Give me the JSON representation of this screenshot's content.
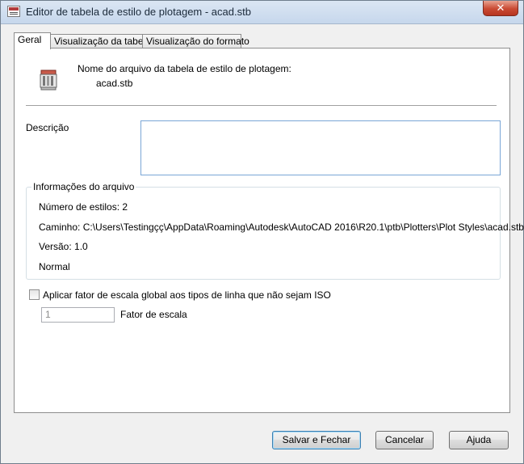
{
  "window": {
    "title": "Editor de tabela de estilo de plotagem - acad.stb",
    "close_glyph": "✕"
  },
  "tabs": [
    {
      "label": "Geral",
      "active": true
    },
    {
      "label": "Visualização da tabela",
      "active": false
    },
    {
      "label": "Visualização do formato",
      "active": false
    }
  ],
  "general": {
    "filename_heading": "Nome do arquivo da tabela de estilo de plotagem:",
    "filename": "acad.stb",
    "description_label": "Descrição",
    "description_value": "",
    "file_info": {
      "group_label": "Informações do arquivo",
      "num_styles": "Número de estilos: 2",
      "path": "Caminho: C:\\Users\\Testingçç\\AppData\\Roaming\\Autodesk\\AutoCAD 2016\\R20.1\\ptb\\Plotters\\Plot Styles\\acad.stb",
      "version": "Versão: 1.0",
      "type": "Normal"
    },
    "apply_scale_label": "Aplicar fator de escala global aos tipos de linha que não sejam ISO",
    "apply_scale_checked": false,
    "scale_factor_value": "1",
    "scale_factor_label": "Fator de escala"
  },
  "buttons": {
    "save_close": "Salvar e Fechar",
    "cancel": "Cancelar",
    "help": "Ajuda"
  },
  "icons": {
    "app": "plot-style-table-icon",
    "file": "plot-style-file-icon"
  }
}
